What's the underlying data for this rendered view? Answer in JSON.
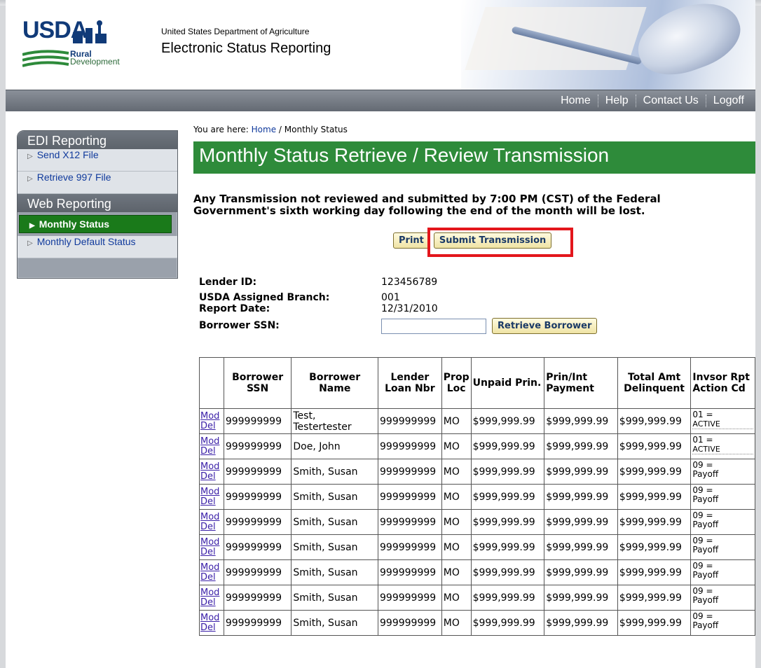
{
  "header": {
    "logo_text": "USDA",
    "logo_sub1": "Rural",
    "logo_sub2": "Development",
    "department": "United States Department of Agriculture",
    "app_name": "Electronic Status Reporting"
  },
  "nav": {
    "links": [
      "Home",
      "Help",
      "Contact Us",
      "Logoff"
    ]
  },
  "sidebar": {
    "section1": "EDI Reporting",
    "items1": [
      "Send X12 File",
      "Retrieve 997 File"
    ],
    "section2": "Web Reporting",
    "items2": [
      "Monthly Status",
      "Monthly Default Status"
    ]
  },
  "breadcrumb": {
    "prefix": "You are here:",
    "home": "Home",
    "separator": "/",
    "current": "Monthly Status"
  },
  "page_title": "Monthly Status Retrieve / Review Transmission",
  "warning": "Any Transmission not reviewed and submitted by 7:00 PM (CST) of the Federal Government's sixth working day following the end of the month will be lost.",
  "buttons": {
    "print": "Print",
    "submit": "Submit Transmission",
    "retrieve": "Retrieve Borrower"
  },
  "info": {
    "lender_id_label": "Lender ID:",
    "lender_id": "123456789",
    "branch_label": "USDA Assigned Branch:",
    "branch": "001",
    "report_date_label": "Report Date:",
    "report_date": "12/31/2010",
    "ssn_label": "Borrower SSN:",
    "ssn_value": ""
  },
  "table": {
    "headers": [
      "",
      "Borrower SSN",
      "Borrower Name",
      "Lender Loan Nbr",
      "Prop Loc",
      "Unpaid Prin.",
      "Prin/Int Payment",
      "Total Amt Delinquent",
      "Invsor Rpt Action Cd"
    ],
    "mod": "Mod",
    "del": "Del",
    "rows": [
      {
        "ssn": "999999999",
        "name": "Test, Testertester",
        "loan": "999999999",
        "loc": "MO",
        "unpaid": "$999,999.99",
        "pi": "$999,999.99",
        "delinq": "$999,999.99",
        "code": "01 =",
        "action": "ACTIVE"
      },
      {
        "ssn": "999999999",
        "name": "Doe, John",
        "loan": "999999999",
        "loc": "MO",
        "unpaid": "$999,999.99",
        "pi": "$999,999.99",
        "delinq": "$999,999.99",
        "code": "01 =",
        "action": "ACTIVE"
      },
      {
        "ssn": "999999999",
        "name": "Smith, Susan",
        "loan": "999999999",
        "loc": "MO",
        "unpaid": "$999,999.99",
        "pi": "$999,999.99",
        "delinq": "$999,999.99",
        "code": "09 =",
        "action": "Payoff"
      },
      {
        "ssn": "999999999",
        "name": "Smith, Susan",
        "loan": "999999999",
        "loc": "MO",
        "unpaid": "$999,999.99",
        "pi": "$999,999.99",
        "delinq": "$999,999.99",
        "code": "09 =",
        "action": "Payoff"
      },
      {
        "ssn": "999999999",
        "name": "Smith, Susan",
        "loan": "999999999",
        "loc": "MO",
        "unpaid": "$999,999.99",
        "pi": "$999,999.99",
        "delinq": "$999,999.99",
        "code": "09 =",
        "action": "Payoff"
      },
      {
        "ssn": "999999999",
        "name": "Smith, Susan",
        "loan": "999999999",
        "loc": "MO",
        "unpaid": "$999,999.99",
        "pi": "$999,999.99",
        "delinq": "$999,999.99",
        "code": "09 =",
        "action": "Payoff"
      },
      {
        "ssn": "999999999",
        "name": "Smith, Susan",
        "loan": "999999999",
        "loc": "MO",
        "unpaid": "$999,999.99",
        "pi": "$999,999.99",
        "delinq": "$999,999.99",
        "code": "09 =",
        "action": "Payoff"
      },
      {
        "ssn": "999999999",
        "name": "Smith, Susan",
        "loan": "999999999",
        "loc": "MO",
        "unpaid": "$999,999.99",
        "pi": "$999,999.99",
        "delinq": "$999,999.99",
        "code": "09 =",
        "action": "Payoff"
      },
      {
        "ssn": "999999999",
        "name": "Smith, Susan",
        "loan": "999999999",
        "loc": "MO",
        "unpaid": "$999,999.99",
        "pi": "$999,999.99",
        "delinq": "$999,999.99",
        "code": "09 =",
        "action": "Payoff"
      }
    ]
  },
  "colors": {
    "title_bar": "#2e8b3a",
    "nav_bar": "#6b717a",
    "active_item": "#1a7a1a",
    "highlight": "#e3161c"
  }
}
